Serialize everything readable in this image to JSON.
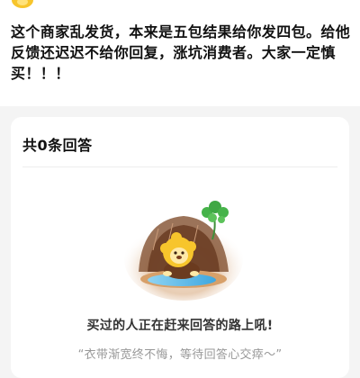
{
  "question": {
    "text": "这个商家乱发货，本来是五包结果给你发四包。给他反馈还迟迟不给你回复，涨坑消费者。大家一定慎买！！！"
  },
  "answers": {
    "count_label": "共0条回答",
    "empty_state": {
      "illustration": "mascot-lion-bear-illustration",
      "title": "买过的人正在赶来回答的路上吼!",
      "subtitle": "“衣带渐宽终不悔，等待回答心交瘁～”"
    }
  },
  "colors": {
    "page_background": "#f4f4f4",
    "card_background": "#ffffff",
    "primary_text": "#111111",
    "secondary_text": "#999999",
    "mascot_yellow": "#f7c52c"
  }
}
